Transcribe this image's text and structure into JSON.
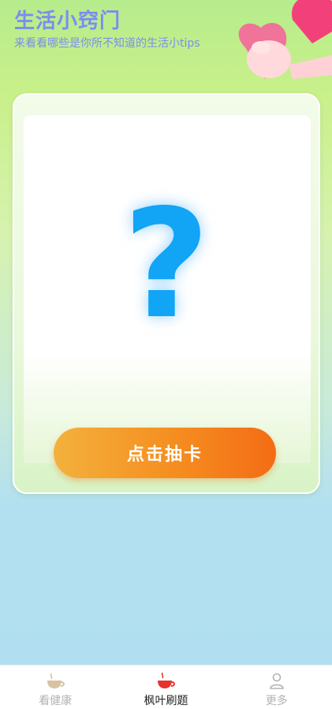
{
  "header": {
    "title": "生活小窍门",
    "subtitle": "来看看哪些是你所不知道的生活小tips"
  },
  "card": {
    "question_mark": "?",
    "draw_button_label": "点击抽卡"
  },
  "tabbar": {
    "tabs": [
      {
        "label": "看健康",
        "icon": "teacup-icon",
        "active": false
      },
      {
        "label": "枫叶刷题",
        "icon": "red-teacup-icon",
        "active": true
      },
      {
        "label": "更多",
        "icon": "person-icon",
        "active": false
      }
    ]
  },
  "colors": {
    "title": "#7c8cf0",
    "question_mark": "#12a4f5",
    "button_start": "#f4b13c",
    "button_end": "#f46c14",
    "active_icon": "#e8322e"
  }
}
